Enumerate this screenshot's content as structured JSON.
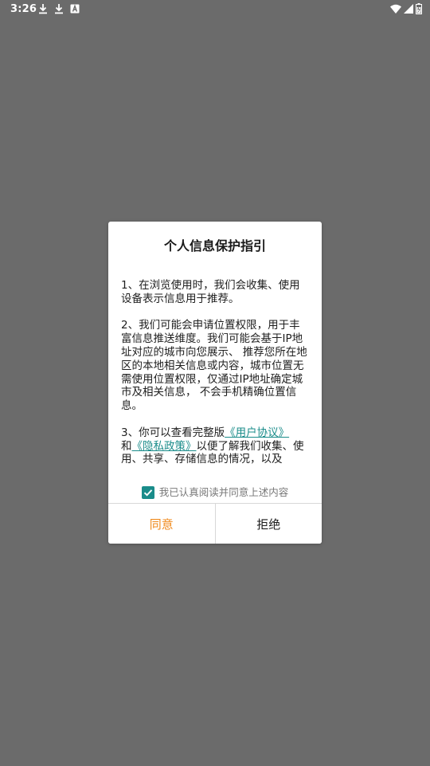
{
  "status_bar": {
    "time": "3:26",
    "left_icons": [
      "download-icon",
      "download-icon",
      "app-notification-icon"
    ],
    "right_icons": [
      "wifi-icon",
      "signal-icon",
      "battery-icon"
    ]
  },
  "dialog": {
    "title": "个人信息保护指引",
    "paragraph1": "1、在浏览使用时，我们会收集、使用设备表示信息用于推荐。",
    "paragraph2": " 2、我们可能会申请位置权限，用于丰富信息推送维度。我们可能会基于IP地址对应的城市向您展示、 推荐您所在地区的本地相关信息或内容，城市位置无需使用位置权限，仅通过IP地址确定城市及相关信息， 不会手机精确位置信息。",
    "paragraph3_prefix": " 3、你可以查看完整版",
    "user_agreement_link": "《用户协议》",
    "paragraph3_and": "和",
    "privacy_policy_link": "《隐私政策》",
    "paragraph3_suffix": "以便了解我们收集、使用、共享、存储信息的情况，以及",
    "consent_label": "我已认真阅读并同意上述内容",
    "consent_checked": true,
    "agree_label": "同意",
    "reject_label": "拒绝"
  },
  "colors": {
    "overlay_background": "#6b6b6b",
    "accent_teal": "#1a8c8a",
    "agree_orange": "#f08a1c"
  }
}
